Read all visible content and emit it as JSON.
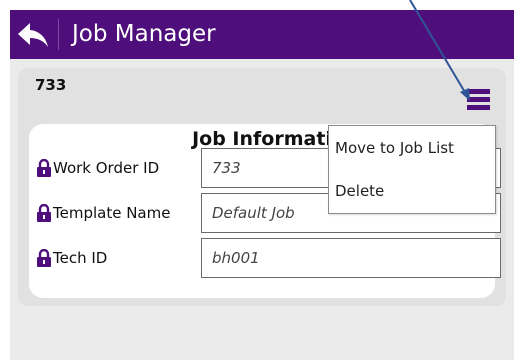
{
  "app": {
    "title": "Job Manager",
    "brand_color": "#4e0f7c",
    "back_icon": "back-arrow-icon"
  },
  "job": {
    "id": "733",
    "menu_icon": "hamburger-menu-icon"
  },
  "section": {
    "title": "Job Informati"
  },
  "fields": [
    {
      "label": "Work Order ID",
      "value": "733"
    },
    {
      "label": "Template Name",
      "value": "Default Job"
    },
    {
      "label": "Tech ID",
      "value": "bh001"
    }
  ],
  "menu": {
    "items": [
      "Move to Job List",
      "Delete"
    ]
  },
  "colors": {
    "lock": "#4e0f7c",
    "annotation_arrow": "#2f5597"
  }
}
